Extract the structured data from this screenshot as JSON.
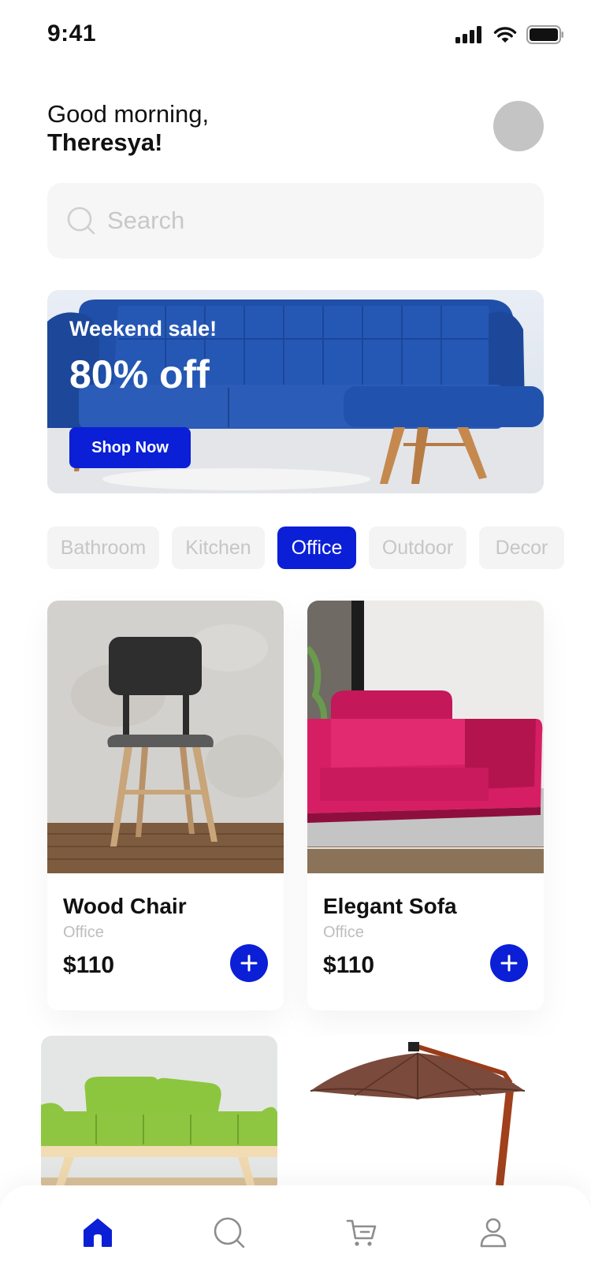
{
  "status_bar": {
    "time": "9:41",
    "icons": [
      "signal-icon",
      "wifi-icon",
      "battery-icon"
    ]
  },
  "greeting": {
    "line1": "Good morning,",
    "name": "Theresya!"
  },
  "search": {
    "placeholder": "Search",
    "value": ""
  },
  "banner": {
    "title": "Weekend sale!",
    "headline": "80% off",
    "button": "Shop Now"
  },
  "categories": [
    {
      "label": "Bathroom",
      "active": false
    },
    {
      "label": "Kitchen",
      "active": false
    },
    {
      "label": "Office",
      "active": true
    },
    {
      "label": "Outdoor",
      "active": false
    },
    {
      "label": "Decor",
      "active": false
    }
  ],
  "products": [
    {
      "name": "Wood Chair",
      "category": "Office",
      "price": "$110"
    },
    {
      "name": "Elegant Sofa",
      "category": "Office",
      "price": "$110"
    }
  ],
  "bottom_nav": [
    {
      "icon": "home-icon",
      "active": true
    },
    {
      "icon": "search-icon",
      "active": false
    },
    {
      "icon": "cart-icon",
      "active": false
    },
    {
      "icon": "profile-icon",
      "active": false
    }
  ],
  "colors": {
    "accent": "#0b1fd6",
    "muted": "#c6c6c6",
    "surface": "#f6f6f6"
  }
}
